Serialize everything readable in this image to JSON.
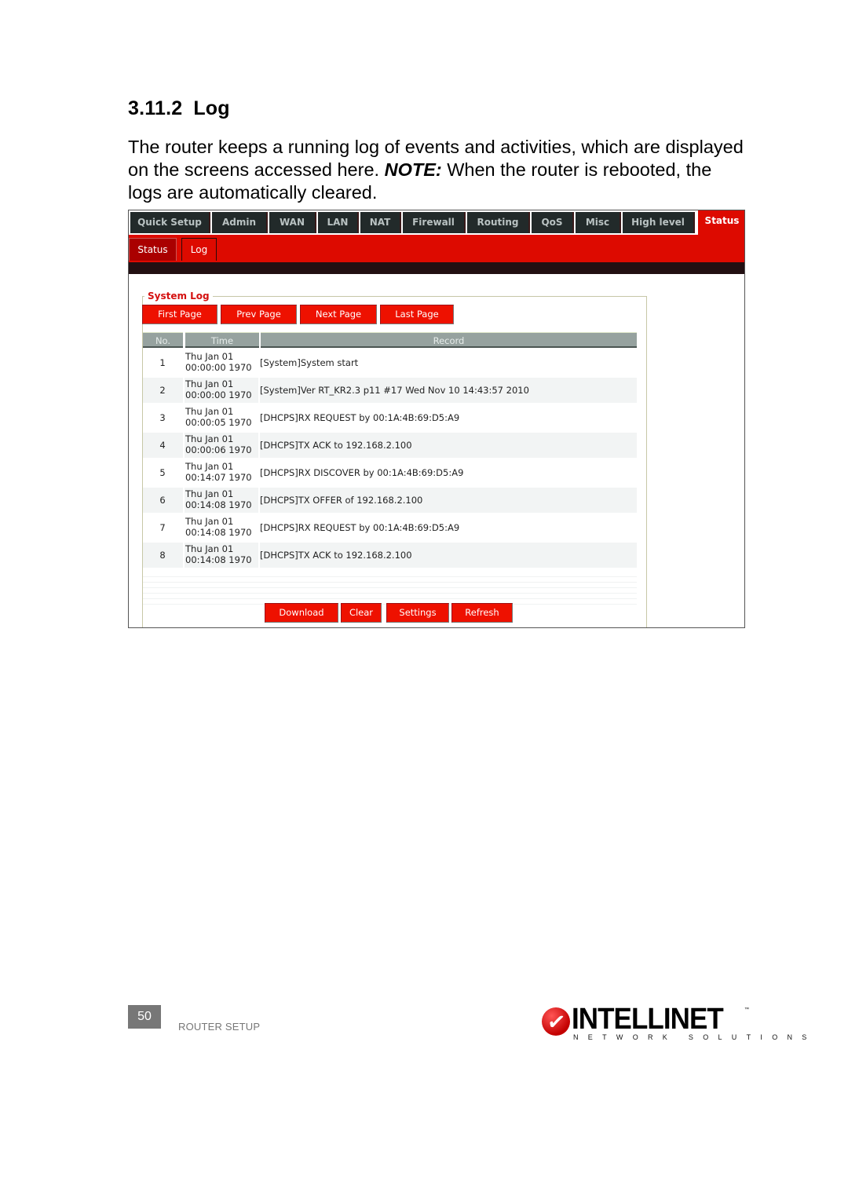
{
  "doc": {
    "section_number": "3.11.2",
    "section_title": "Log",
    "paragraph_pre": "The router keeps a running log of events and activities, which are displayed on the screens accessed here. ",
    "note_label": "NOTE:",
    "paragraph_post": " When the router is rebooted, the logs are automatically cleared."
  },
  "router_ui": {
    "top_nav": [
      {
        "label": "Quick Setup"
      },
      {
        "label": "Admin"
      },
      {
        "label": "WAN"
      },
      {
        "label": "LAN"
      },
      {
        "label": "NAT"
      },
      {
        "label": "Firewall"
      },
      {
        "label": "Routing"
      },
      {
        "label": "QoS"
      },
      {
        "label": "Misc"
      },
      {
        "label": "High level"
      },
      {
        "label": "Status",
        "active": true
      }
    ],
    "sub_nav": [
      {
        "label": "Status"
      },
      {
        "label": "Log",
        "active": true
      }
    ],
    "panel_title": "System Log",
    "paging_buttons": {
      "first": "First Page",
      "prev": "Prev Page",
      "next": "Next Page",
      "last": "Last Page"
    },
    "table": {
      "headers": {
        "no": "No.",
        "time": "Time",
        "record": "Record"
      },
      "rows": [
        {
          "no": "1",
          "time_day": "Thu Jan 01",
          "time_clock": "00:00:00 1970",
          "record": "[System]System start"
        },
        {
          "no": "2",
          "time_day": "Thu Jan 01",
          "time_clock": "00:00:00 1970",
          "record": "[System]Ver RT_KR2.3 p11 #17 Wed Nov 10 14:43:57 2010"
        },
        {
          "no": "3",
          "time_day": "Thu Jan 01",
          "time_clock": "00:00:05 1970",
          "record": "[DHCPS]RX REQUEST by 00:1A:4B:69:D5:A9"
        },
        {
          "no": "4",
          "time_day": "Thu Jan 01",
          "time_clock": "00:00:06 1970",
          "record": "[DHCPS]TX ACK to 192.168.2.100"
        },
        {
          "no": "5",
          "time_day": "Thu Jan 01",
          "time_clock": "00:14:07 1970",
          "record": "[DHCPS]RX DISCOVER by 00:1A:4B:69:D5:A9"
        },
        {
          "no": "6",
          "time_day": "Thu Jan 01",
          "time_clock": "00:14:08 1970",
          "record": "[DHCPS]TX OFFER of 192.168.2.100"
        },
        {
          "no": "7",
          "time_day": "Thu Jan 01",
          "time_clock": "00:14:08 1970",
          "record": "[DHCPS]RX REQUEST by 00:1A:4B:69:D5:A9"
        },
        {
          "no": "8",
          "time_day": "Thu Jan 01",
          "time_clock": "00:14:08 1970",
          "record": "[DHCPS]TX ACK to 192.168.2.100"
        }
      ]
    },
    "action_buttons": {
      "download": "Download",
      "clear": "Clear",
      "settings": "Settings",
      "refresh": "Refresh"
    },
    "colors": {
      "accent_red": "#dd0a00",
      "nav_dark": "#222a2a",
      "header_gray": "#96a29f"
    }
  },
  "footer": {
    "page_number": "50",
    "section_label": "ROUTER SETUP",
    "logo_word": "INTELLINET",
    "logo_tagline": "NETWORK SOLUTIONS",
    "logo_tm": "™",
    "logo_check": "✓"
  }
}
